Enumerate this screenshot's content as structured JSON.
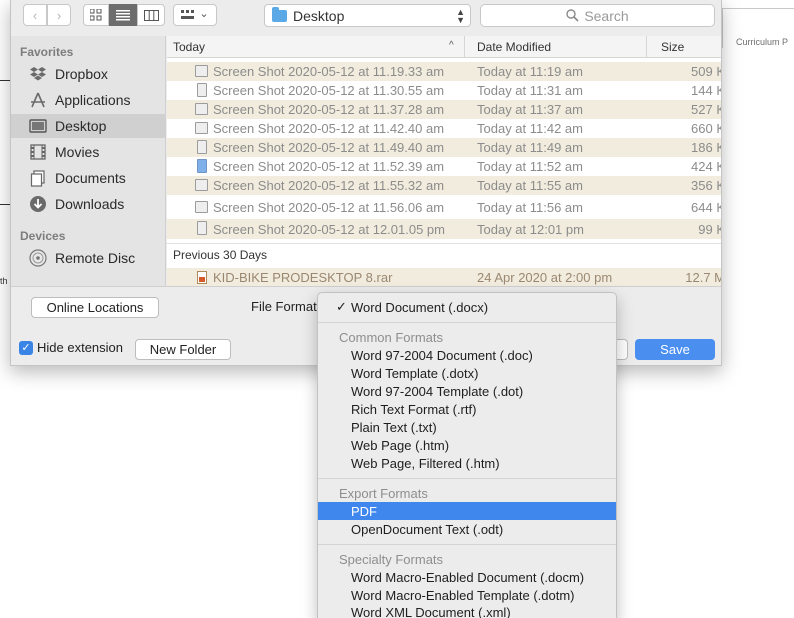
{
  "background": {
    "curriculum_text": "Curriculum P",
    "left_fragment": "th"
  },
  "toolbar": {
    "back_icon": "chevron-left-icon",
    "forward_icon": "chevron-right-icon",
    "view_icon_glyph": "▦",
    "view_list_glyph": "☰",
    "view_column_glyph": "▥",
    "group_glyph": "▦",
    "group_chevron": "⌄",
    "back_glyph": "‹",
    "forward_glyph": "›",
    "location": "Desktop",
    "search_placeholder": "Search"
  },
  "sidebar": {
    "favorites_heading": "Favorites",
    "devices_heading": "Devices",
    "favorites": [
      {
        "label": "Dropbox",
        "icon": "dropbox-icon"
      },
      {
        "label": "Applications",
        "icon": "applications-icon"
      },
      {
        "label": "Desktop",
        "icon": "desktop-icon",
        "selected": true
      },
      {
        "label": "Movies",
        "icon": "movies-icon"
      },
      {
        "label": "Documents",
        "icon": "documents-icon"
      },
      {
        "label": "Downloads",
        "icon": "downloads-icon"
      }
    ],
    "devices": [
      {
        "label": "Remote Disc",
        "icon": "disc-icon"
      }
    ]
  },
  "file_list": {
    "columns": {
      "name": "Today",
      "date": "Date Modified",
      "size": "Size"
    },
    "today_files": [
      {
        "name": "Screen Shot 2020-05-12 at 11.19.33 am",
        "date": "Today at 11:19 am",
        "size": "509 K"
      },
      {
        "name": "Screen Shot 2020-05-12 at 11.30.55 am",
        "date": "Today at 11:31 am",
        "size": "144 K"
      },
      {
        "name": "Screen Shot 2020-05-12 at 11.37.28 am",
        "date": "Today at 11:37 am",
        "size": "527 K"
      },
      {
        "name": "Screen Shot 2020-05-12 at 11.42.40 am",
        "date": "Today at 11:42 am",
        "size": "660 K"
      },
      {
        "name": "Screen Shot 2020-05-12 at 11.49.40 am",
        "date": "Today at 11:49 am",
        "size": "186 K"
      },
      {
        "name": "Screen Shot 2020-05-12 at 11.52.39 am",
        "date": "Today at 11:52 am",
        "size": "424 K"
      },
      {
        "name": "Screen Shot 2020-05-12 at 11.55.32 am",
        "date": "Today at 11:55 am",
        "size": "356 K"
      },
      {
        "name": "Screen Shot 2020-05-12 at 11.56.06 am",
        "date": "Today at 11:56 am",
        "size": "644 K"
      },
      {
        "name": "Screen Shot 2020-05-12 at 12.01.05 pm",
        "date": "Today at 12:01 pm",
        "size": "99 K"
      }
    ],
    "previous_group_label": "Previous 30 Days",
    "previous_files": [
      {
        "name": "KID-BIKE PRODESKTOP 8.rar",
        "date": "24 Apr 2020 at 2:00 pm",
        "size": "12.7 M"
      }
    ]
  },
  "controls": {
    "online_locations": "Online Locations",
    "file_format_label": "File Format",
    "hide_extension": "Hide extension",
    "new_folder": "New Folder",
    "save": "Save",
    "checkmark": "✓"
  },
  "format_menu": {
    "current": "Word Document (.docx)",
    "check_glyph": "✓",
    "common_heading": "Common Formats",
    "common": [
      "Word 97-2004 Document (.doc)",
      "Word Template (.dotx)",
      "Word 97-2004 Template (.dot)",
      "Rich Text Format (.rtf)",
      "Plain Text (.txt)",
      "Web Page (.htm)",
      "Web Page, Filtered (.htm)"
    ],
    "export_heading": "Export Formats",
    "export": [
      "PDF",
      "OpenDocument Text (.odt)"
    ],
    "highlighted": "PDF",
    "specialty_heading": "Specialty Formats",
    "specialty": [
      "Word Macro-Enabled Document (.docm)",
      "Word Macro-Enabled Template (.dotm)",
      "Word XML Document (.xml)"
    ]
  }
}
